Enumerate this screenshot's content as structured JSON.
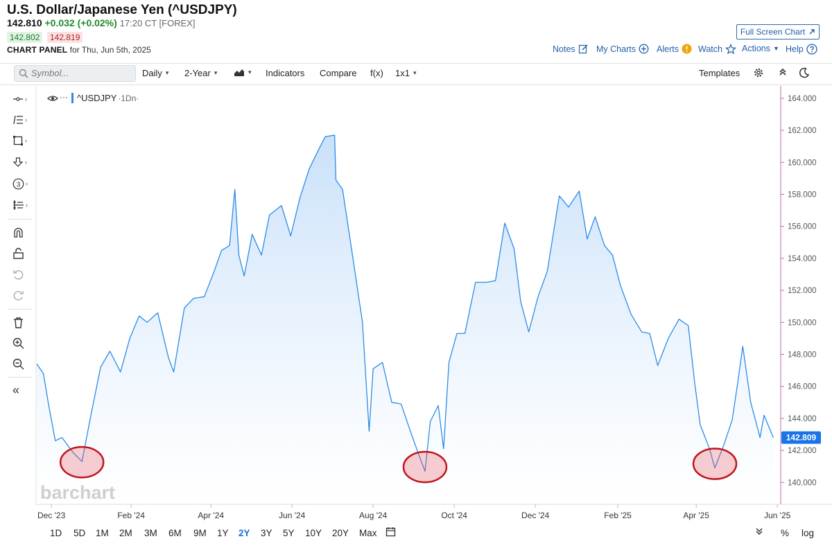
{
  "header": {
    "title": "U.S. Dollar/Japanese Yen (^USDJPY)",
    "last": "142.810",
    "change": "+0.032 (+0.02%)",
    "time": "17:20 CT [FOREX]",
    "bid": "142.802",
    "ask": "142.819",
    "panel_label": "CHART PANEL",
    "panel_date": "for Thu, Jun 5th, 2025",
    "full_screen": "Full Screen Chart"
  },
  "top_links": {
    "notes": "Notes",
    "my_charts": "My Charts",
    "alerts": "Alerts",
    "watch": "Watch",
    "actions": "Actions",
    "help": "Help"
  },
  "toolbar": {
    "symbol_placeholder": "Symbol...",
    "interval": "Daily",
    "range": "2-Year",
    "indicators": "Indicators",
    "compare": "Compare",
    "fx": "f(x)",
    "layout": "1x1",
    "templates": "Templates"
  },
  "legend": {
    "series": "^USDJPY",
    "suffix": "·1Dn·"
  },
  "watermark": "barchart",
  "periods": [
    "1D",
    "5D",
    "1M",
    "2M",
    "3M",
    "6M",
    "9M",
    "1Y",
    "2Y",
    "3Y",
    "5Y",
    "10Y",
    "20Y",
    "Max"
  ],
  "active_period": "2Y",
  "bottom_right": {
    "percent": "%",
    "log": "log"
  },
  "colors": {
    "line": "#2b8be6",
    "area_top": "#c6dffa",
    "price_tag": "#1a73e8",
    "highlight_circle": "#c0141c"
  },
  "chart_data": {
    "type": "area",
    "series": [
      {
        "name": "^USDJPY",
        "x": [
          "2023-11-29",
          "2023-12-04",
          "2023-12-08",
          "2023-12-13",
          "2023-12-18",
          "2023-12-26",
          "2024-01-02",
          "2024-01-09",
          "2024-01-16",
          "2024-01-23",
          "2024-01-31",
          "2024-02-07",
          "2024-02-14",
          "2024-02-20",
          "2024-02-28",
          "2024-03-07",
          "2024-03-11",
          "2024-03-19",
          "2024-03-26",
          "2024-04-03",
          "2024-04-10",
          "2024-04-16",
          "2024-04-22",
          "2024-04-26",
          "2024-04-29",
          "2024-05-03",
          "2024-05-09",
          "2024-05-16",
          "2024-05-22",
          "2024-05-31",
          "2024-06-07",
          "2024-06-14",
          "2024-06-21",
          "2024-06-28",
          "2024-07-03",
          "2024-07-10",
          "2024-07-11",
          "2024-07-16",
          "2024-07-24",
          "2024-07-31",
          "2024-08-05",
          "2024-08-08",
          "2024-08-15",
          "2024-08-22",
          "2024-08-29",
          "2024-09-05",
          "2024-09-11",
          "2024-09-16",
          "2024-09-20",
          "2024-09-26",
          "2024-09-30",
          "2024-10-04",
          "2024-10-10",
          "2024-10-16",
          "2024-10-24",
          "2024-11-01",
          "2024-11-08",
          "2024-11-15",
          "2024-11-22",
          "2024-11-27",
          "2024-12-03",
          "2024-12-10",
          "2024-12-17",
          "2024-12-26",
          "2025-01-02",
          "2025-01-10",
          "2025-01-16",
          "2025-01-22",
          "2025-01-29",
          "2025-02-04",
          "2025-02-10",
          "2025-02-18",
          "2025-02-26",
          "2025-03-04",
          "2025-03-10",
          "2025-03-18",
          "2025-03-26",
          "2025-04-02",
          "2025-04-07",
          "2025-04-11",
          "2025-04-18",
          "2025-04-22",
          "2025-04-29",
          "2025-05-05",
          "2025-05-09",
          "2025-05-13",
          "2025-05-19",
          "2025-05-26",
          "2025-05-29",
          "2025-06-05"
        ],
        "values": [
          147.4,
          146.8,
          144.8,
          142.6,
          142.8,
          141.9,
          141.3,
          144.3,
          147.2,
          148.2,
          146.9,
          149.0,
          150.4,
          150.0,
          150.6,
          147.8,
          146.9,
          150.9,
          151.5,
          151.6,
          153.1,
          154.5,
          154.8,
          158.3,
          154.2,
          152.9,
          155.5,
          154.2,
          156.7,
          157.3,
          155.4,
          157.8,
          159.6,
          160.8,
          161.6,
          161.7,
          158.9,
          158.3,
          153.9,
          150.0,
          143.2,
          147.1,
          147.5,
          145.0,
          144.9,
          143.2,
          141.8,
          140.7,
          143.8,
          144.8,
          142.1,
          147.5,
          149.3,
          149.3,
          152.5,
          152.5,
          152.6,
          156.2,
          154.6,
          151.3,
          149.4,
          151.6,
          153.2,
          157.9,
          157.2,
          158.2,
          155.2,
          156.6,
          154.8,
          154.2,
          152.3,
          150.5,
          149.4,
          149.3,
          147.3,
          149.0,
          150.2,
          149.8,
          146.1,
          143.6,
          142.1,
          140.9,
          142.4,
          143.9,
          146.1,
          148.5,
          145.0,
          142.8,
          144.2,
          142.8
        ]
      }
    ],
    "annotations": [
      {
        "date": "2024-01-02",
        "value": 141.0,
        "shape": "circle"
      },
      {
        "date": "2024-09-16",
        "value": 140.7,
        "shape": "circle"
      },
      {
        "date": "2025-04-22",
        "value": 140.9,
        "shape": "circle"
      }
    ],
    "x_range": [
      "2023-11-29",
      "2025-06-10"
    ],
    "ylim": [
      138.8,
      164.6
    ],
    "y_ticks": [
      140.0,
      142.0,
      144.0,
      146.0,
      148.0,
      150.0,
      152.0,
      154.0,
      156.0,
      158.0,
      160.0,
      162.0,
      164.0
    ],
    "x_ticks": [
      {
        "date": "2023-12-10",
        "label": "Dec '23"
      },
      {
        "date": "2024-02-08",
        "label": "Feb '24"
      },
      {
        "date": "2024-04-08",
        "label": "Apr '24"
      },
      {
        "date": "2024-06-08",
        "label": "Jun '24"
      },
      {
        "date": "2024-08-08",
        "label": "Aug '24"
      },
      {
        "date": "2024-10-08",
        "label": "Oct '24"
      },
      {
        "date": "2024-12-08",
        "label": "Dec '24"
      },
      {
        "date": "2025-02-08",
        "label": "Feb '25"
      },
      {
        "date": "2025-04-08",
        "label": "Apr '25"
      },
      {
        "date": "2025-06-08",
        "label": "Jun '25"
      }
    ],
    "last_price_label": "142.809",
    "grid": false
  }
}
